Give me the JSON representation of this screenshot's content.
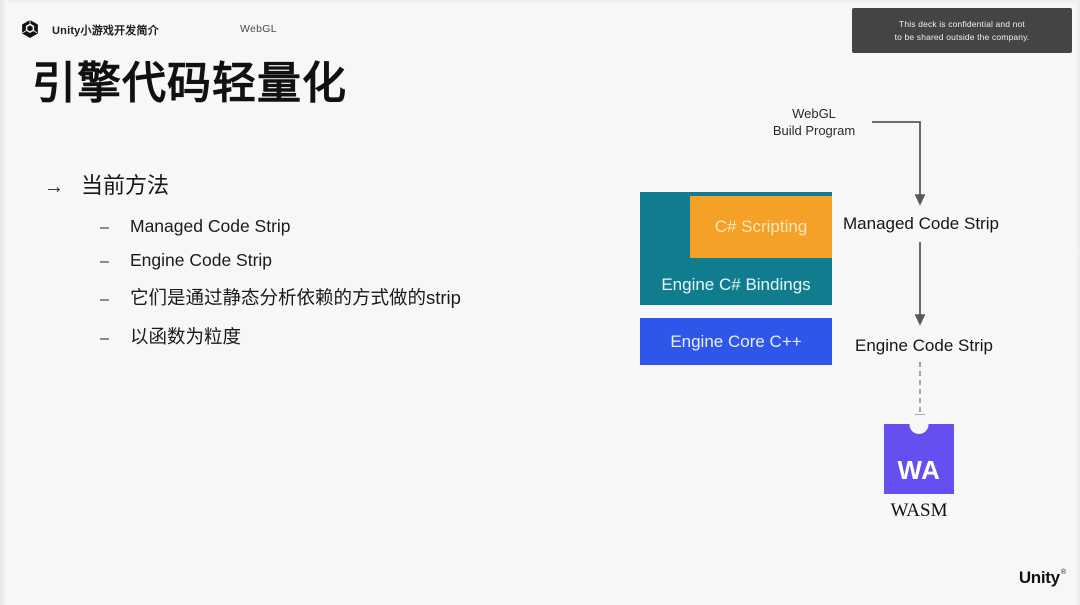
{
  "header": {
    "logo_icon": "unity-cube-icon",
    "deck_title": "Unity小游戏开发简介",
    "section": "WebGL",
    "confidential_line1": "This deck is confidential and not",
    "confidential_line2": "to be shared outside the company."
  },
  "title": "引擎代码轻量化",
  "bullets": {
    "arrow_glyph": "→",
    "dash_glyph": "–",
    "level1": "当前方法",
    "level2": [
      "Managed Code Strip",
      "Engine Code Strip",
      "它们是通过静态分析依赖的方式做的strip",
      "以函数为粒度"
    ]
  },
  "diagram": {
    "stack": {
      "scripting": "C# Scripting",
      "bindings": "Engine C# Bindings",
      "core": "Engine Core C++"
    },
    "flow": {
      "build_program_line1": "WebGL",
      "build_program_line2": "Build Program",
      "step_managed": "Managed Code Strip",
      "step_engine": "Engine Code Strip",
      "wasm_letters": "WA",
      "wasm_caption": "WASM"
    }
  },
  "footer": {
    "brand": "Unity",
    "registered": "®"
  },
  "colors": {
    "background": "#f7f7f7",
    "teal": "#0f7d8e",
    "orange": "#f5a127",
    "blue": "#2e56e8",
    "wasm_purple": "#654ff0",
    "confidential_bg": "#444444",
    "arrow": "#5a5a5a"
  }
}
